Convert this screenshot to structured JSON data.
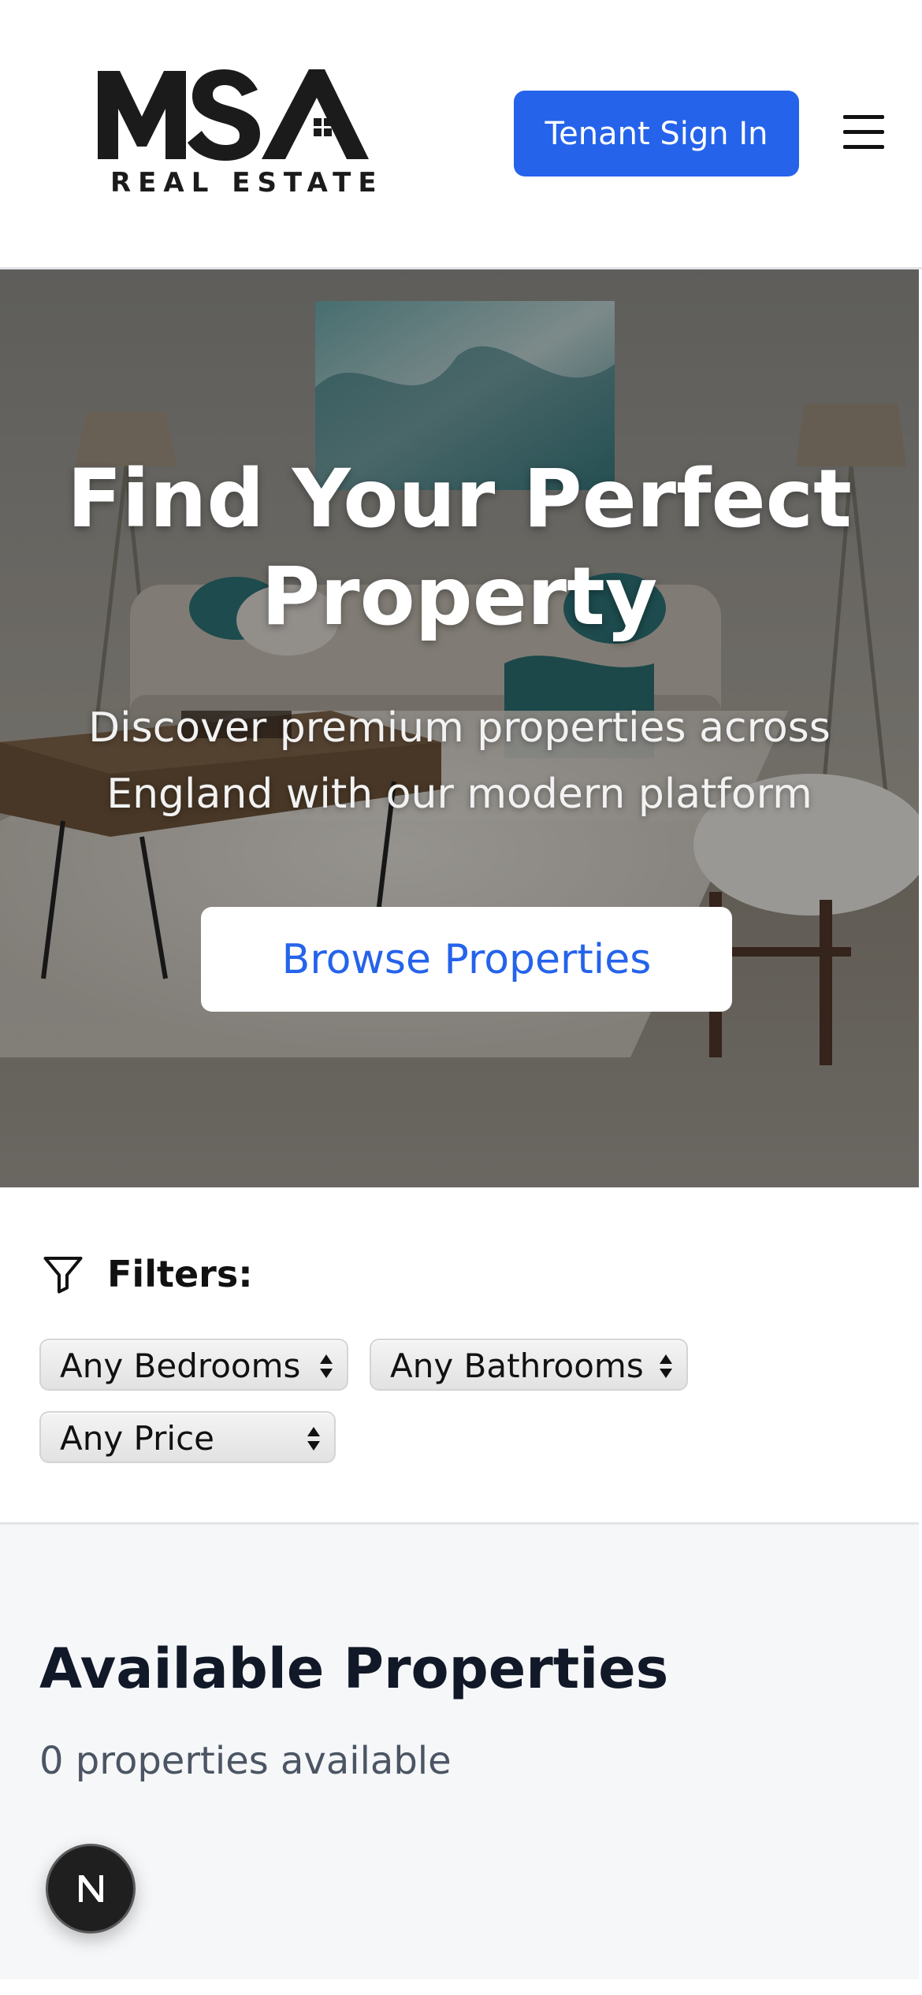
{
  "header": {
    "logo": {
      "wordmark": "MSA",
      "subtitle": "REAL ESTATE"
    },
    "signin_label": "Tenant Sign In",
    "menu_icon": "hamburger-menu-icon"
  },
  "hero": {
    "background": "living-room-photo",
    "title": "Find Your Perfect Property",
    "subtitle": "Discover premium properties across England with our modern platform",
    "cta_label": "Browse Properties"
  },
  "filters": {
    "icon": "funnel-icon",
    "label": "Filters:",
    "bedrooms": "Any Bedrooms",
    "bathrooms": "Any Bathrooms",
    "price": "Any Price"
  },
  "properties": {
    "title": "Available Properties",
    "count_text": "0 properties available"
  },
  "badge": {
    "letter": "N"
  },
  "colors": {
    "primary": "#2563eb",
    "text_dark": "#111827",
    "text_muted": "#4b5563",
    "section_bg": "#f6f7f9"
  }
}
